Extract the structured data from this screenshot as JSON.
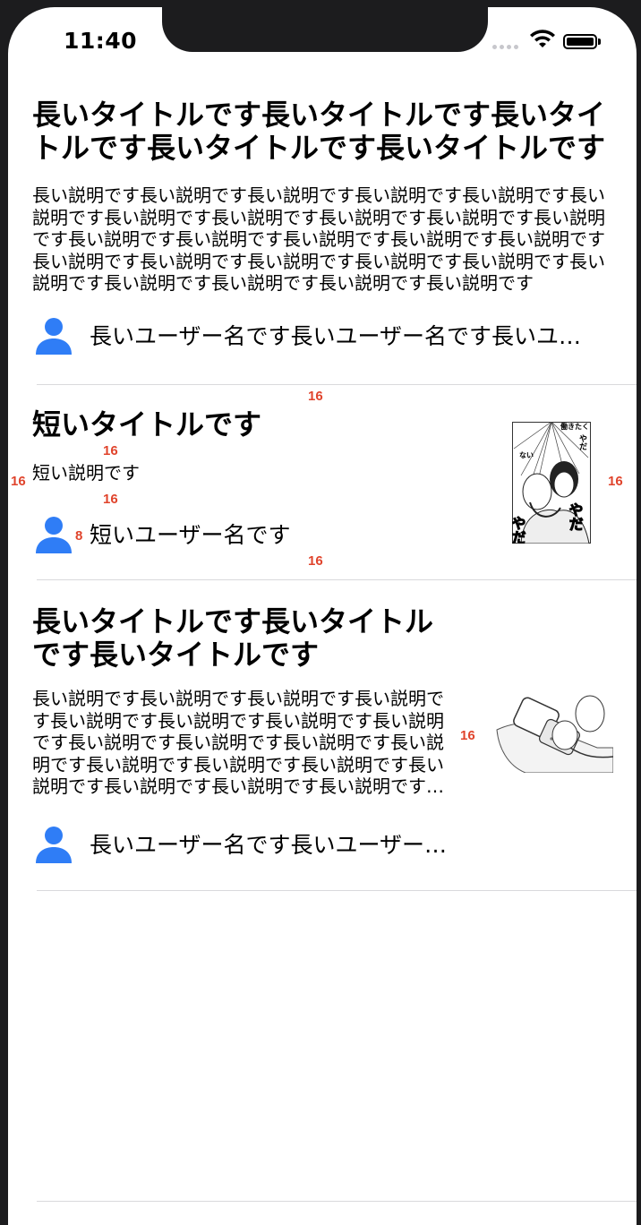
{
  "status_bar": {
    "time": "11:40"
  },
  "items": [
    {
      "title": "長いタイトルです長いタイトルです長いタイトルです長いタイトルです長いタイトルです",
      "description": "長い説明です長い説明です長い説明です長い説明です長い説明です長い説明です長い説明です長い説明です長い説明です長い説明です長い説明です長い説明です長い説明です長い説明です長い説明です長い説明です長い説明です長い説明です長い説明です長い説明です長い説明です長い説明です長い説明です長い説明です長い説明です長い説明です",
      "username": "長いユーザー名です長いユーザー名です長いユーザー名です"
    },
    {
      "title": "短いタイトルです",
      "description": "短い説明です",
      "username": "短いユーザー名です"
    },
    {
      "title": "長いタイトルです長いタイトルです長いタイトルです",
      "description": "長い説明です長い説明です長い説明です長い説明です長い説明です長い説明です長い説明です長い説明です長い説明です長い説明です長い説明です長い説明です長い説明です長い説明です長い説明です長い説明です長い説明です長い説明です長い説明です長い説明です長い説明です",
      "username": "長いユーザー名です長いユーザー名です"
    }
  ],
  "annotations": {
    "sep_to_title": "16",
    "title_to_desc": "16",
    "left_margin": "16",
    "desc_to_user": "16",
    "avatar_to_name": "8",
    "user_to_sep": "16",
    "right_margin": "16",
    "text_to_thumb": "16"
  },
  "colors": {
    "accent": "#2f7df6",
    "annotation": "#e0442c"
  },
  "icons": [
    "person-icon",
    "wifi-icon",
    "battery-icon",
    "signal-icon"
  ]
}
